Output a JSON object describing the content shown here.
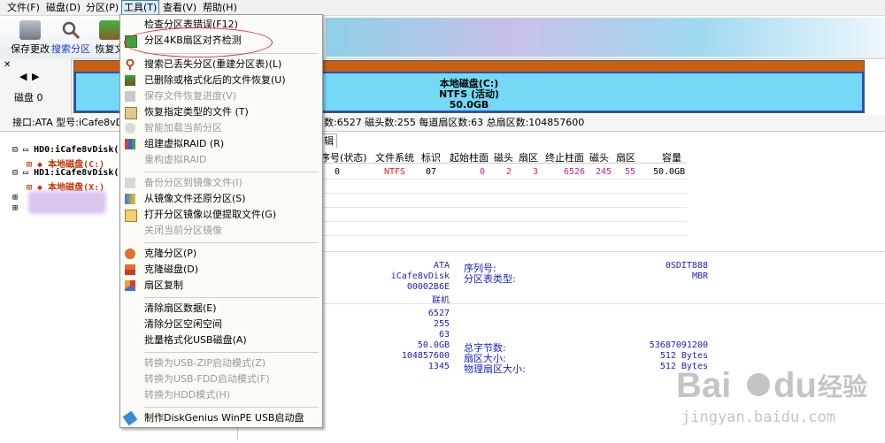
{
  "menubar": {
    "items": [
      "文件(F)",
      "磁盘(D)",
      "分区(P)",
      "工具(T)",
      "查看(V)",
      "帮助(H)"
    ]
  },
  "toolbar": {
    "buttons": [
      "保存更改",
      "搜索分区",
      "恢复文"
    ]
  },
  "disk": {
    "label": "磁盘 0",
    "partition_name": "本地磁盘(C:)",
    "partition_fs": "NTFS (活动)",
    "partition_size": "50.0GB"
  },
  "infoline": {
    "left": "接口:ATA  型号:iCafe8vDisk",
    "right": "数:6527  磁头数:255  每道扇区数:63  总扇区数:104857600"
  },
  "tree": {
    "hd0": "HD0:iCafe8vDisk(",
    "hd0_part": "本地磁盘(C:)",
    "hd1": "HD1:iCafe8vDisk(",
    "hd1_part": "本地磁盘(X:)"
  },
  "tab": "辑",
  "table": {
    "headers": [
      "序号(状态)",
      "文件系统",
      "标识",
      "起始柱面",
      "磁头",
      "扇区",
      "终止柱面",
      "磁头",
      "扇区",
      "容量"
    ],
    "row": [
      "0",
      "NTFS",
      "07",
      "0",
      "2",
      "3",
      "6526",
      "245",
      "55",
      "50.0GB"
    ]
  },
  "details": {
    "values_left": [
      "ATA",
      "iCafe8vDisk",
      "00002B6E",
      "联机"
    ],
    "labels_mid": [
      "序列号:",
      "分区表类型:"
    ],
    "values_right": [
      "0SDIT888",
      "MBR"
    ],
    "values_left2": [
      "6527",
      "255",
      "63",
      "50.0GB",
      "104857600",
      "1345"
    ],
    "labels_mid2": [
      "总字节数:",
      "扇区大小:",
      "物理扇区大小:"
    ],
    "values_right2": [
      "53687091200",
      "512 Bytes",
      "512 Bytes"
    ]
  },
  "menu": {
    "items": [
      {
        "label": "检查分区表错误(F12)",
        "disabled": false,
        "icon": "none"
      },
      {
        "label": "分区4KB扇区对齐检测",
        "disabled": false,
        "icon": "align-check-icon"
      },
      {
        "label": "搜索已丢失分区(重建分区表)(L)",
        "disabled": false,
        "icon": "search-lost-icon"
      },
      {
        "label": "已删除或格式化后的文件恢复(U)",
        "disabled": false,
        "icon": "file-recovery-icon"
      },
      {
        "label": "保存文件恢复进度(V)",
        "disabled": true,
        "icon": "save-progress-icon"
      },
      {
        "label": "恢复指定类型的文件 (T)",
        "disabled": false,
        "icon": "type-recovery-icon"
      },
      {
        "label": "智能加载当前分区",
        "disabled": true,
        "icon": "smart-load-icon"
      },
      {
        "label": "组建虚拟RAID (R)",
        "disabled": false,
        "icon": "raid-icon"
      },
      {
        "label": "重构虚拟RAID",
        "disabled": true,
        "icon": "none"
      },
      {
        "label": "备份分区到镜像文件(I)",
        "disabled": true,
        "icon": "backup-icon"
      },
      {
        "label": "从镜像文件还原分区(S)",
        "disabled": false,
        "icon": "restore-icon"
      },
      {
        "label": "打开分区镜像以便提取文件(G)",
        "disabled": false,
        "icon": "open-image-icon"
      },
      {
        "label": "关闭当前分区镜像",
        "disabled": true,
        "icon": "none"
      },
      {
        "label": "克隆分区(P)",
        "disabled": false,
        "icon": "clone-partition-icon"
      },
      {
        "label": "克隆磁盘(D)",
        "disabled": false,
        "icon": "clone-disk-icon"
      },
      {
        "label": "扇区复制",
        "disabled": false,
        "icon": "sector-copy-icon"
      },
      {
        "label": "清除扇区数据(E)",
        "disabled": false,
        "icon": "none"
      },
      {
        "label": "清除分区空闲空间",
        "disabled": false,
        "icon": "none"
      },
      {
        "label": "批量格式化USB磁盘(A)",
        "disabled": false,
        "icon": "none"
      },
      {
        "label": "转换为USB-ZIP启动模式(Z)",
        "disabled": true,
        "icon": "none"
      },
      {
        "label": "转换为USB-FDD启动模式(F)",
        "disabled": true,
        "icon": "none"
      },
      {
        "label": "转换为HDD模式(H)",
        "disabled": true,
        "icon": "none"
      },
      {
        "label": "制作DiskGenius WinPE USB启动盘",
        "disabled": false,
        "icon": "usb-boot-icon"
      }
    ]
  },
  "watermark": {
    "line1": "Bai",
    "line2": "du",
    "line3": "经验",
    "url": "jingyan.baidu.com"
  },
  "colors": {
    "accent": "#3c7fb1",
    "partition_fill": "#74d9f4",
    "partition_border": "#2a4fbf",
    "partition_top": "#c86010",
    "circle": "#e8283a",
    "value_text": "#1a22c8"
  }
}
